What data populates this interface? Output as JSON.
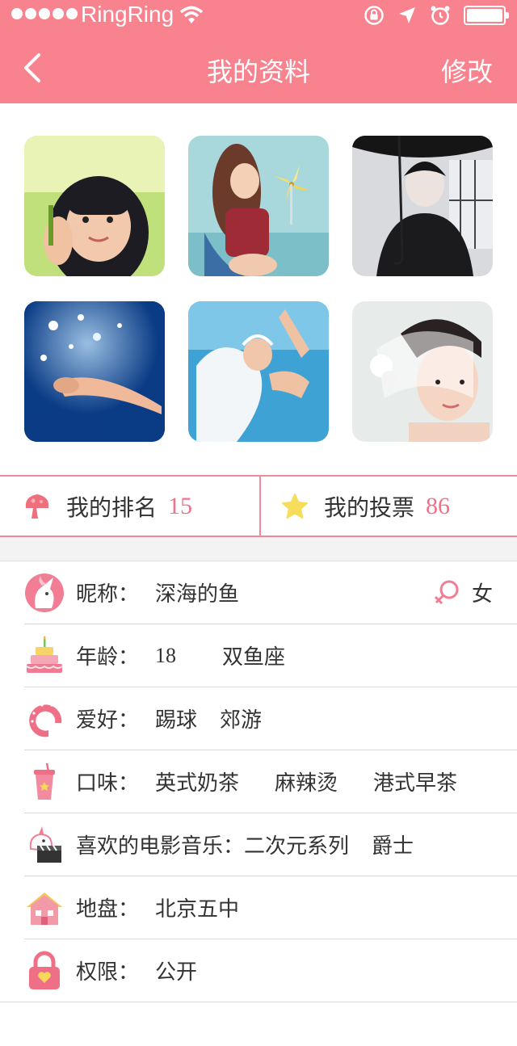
{
  "status": {
    "carrier": "RingRing",
    "icons": [
      "signal-dots",
      "wifi-icon",
      "rotation-lock-icon",
      "location-arrow-icon",
      "alarm-icon",
      "battery-icon"
    ]
  },
  "nav": {
    "back_icon": "chevron-left-icon",
    "title": "我的资料",
    "edit_label": "修改"
  },
  "photos": [
    {
      "subject": "girl-with-bangs"
    },
    {
      "subject": "girl-with-pinwheel"
    },
    {
      "subject": "man-with-umbrella"
    },
    {
      "subject": "person-swimming"
    },
    {
      "subject": "underwater-bride"
    },
    {
      "subject": "bride-with-veil"
    }
  ],
  "stats": {
    "rank": {
      "label": "我的排名",
      "value": "15",
      "icon": "mushroom-icon"
    },
    "votes": {
      "label": "我的投票",
      "value": "86",
      "icon": "star-icon"
    }
  },
  "profile": {
    "nickname": {
      "label": "昵称：",
      "value": "深海的鱼",
      "gender": "女",
      "icon": "unicorn-avatar-icon",
      "gender_icon": "female-icon"
    },
    "age": {
      "label": "年龄：",
      "value": "18",
      "zodiac": "双鱼座",
      "icon": "birthday-cake-icon"
    },
    "hobby": {
      "label": "爱好：",
      "values": [
        "踢球",
        "郊游"
      ],
      "icon": "horseshoe-icon"
    },
    "taste": {
      "label": "口味：",
      "values": [
        "英式奶茶",
        "麻辣烫",
        "港式早茶"
      ],
      "icon": "drink-cup-icon"
    },
    "movies": {
      "label": "喜欢的电影音乐：",
      "values": [
        "二次元系列",
        "爵士"
      ],
      "icon": "unicorn-clapperboard-icon"
    },
    "territory": {
      "label": "地盘：",
      "value": "北京五中",
      "icon": "house-icon"
    },
    "privacy": {
      "label": "权限：",
      "value": "公开",
      "icon": "lock-icon"
    }
  },
  "colors": {
    "accent": "#f9828f",
    "value_pink": "#f0728a",
    "divider": "#d8d8d8"
  }
}
